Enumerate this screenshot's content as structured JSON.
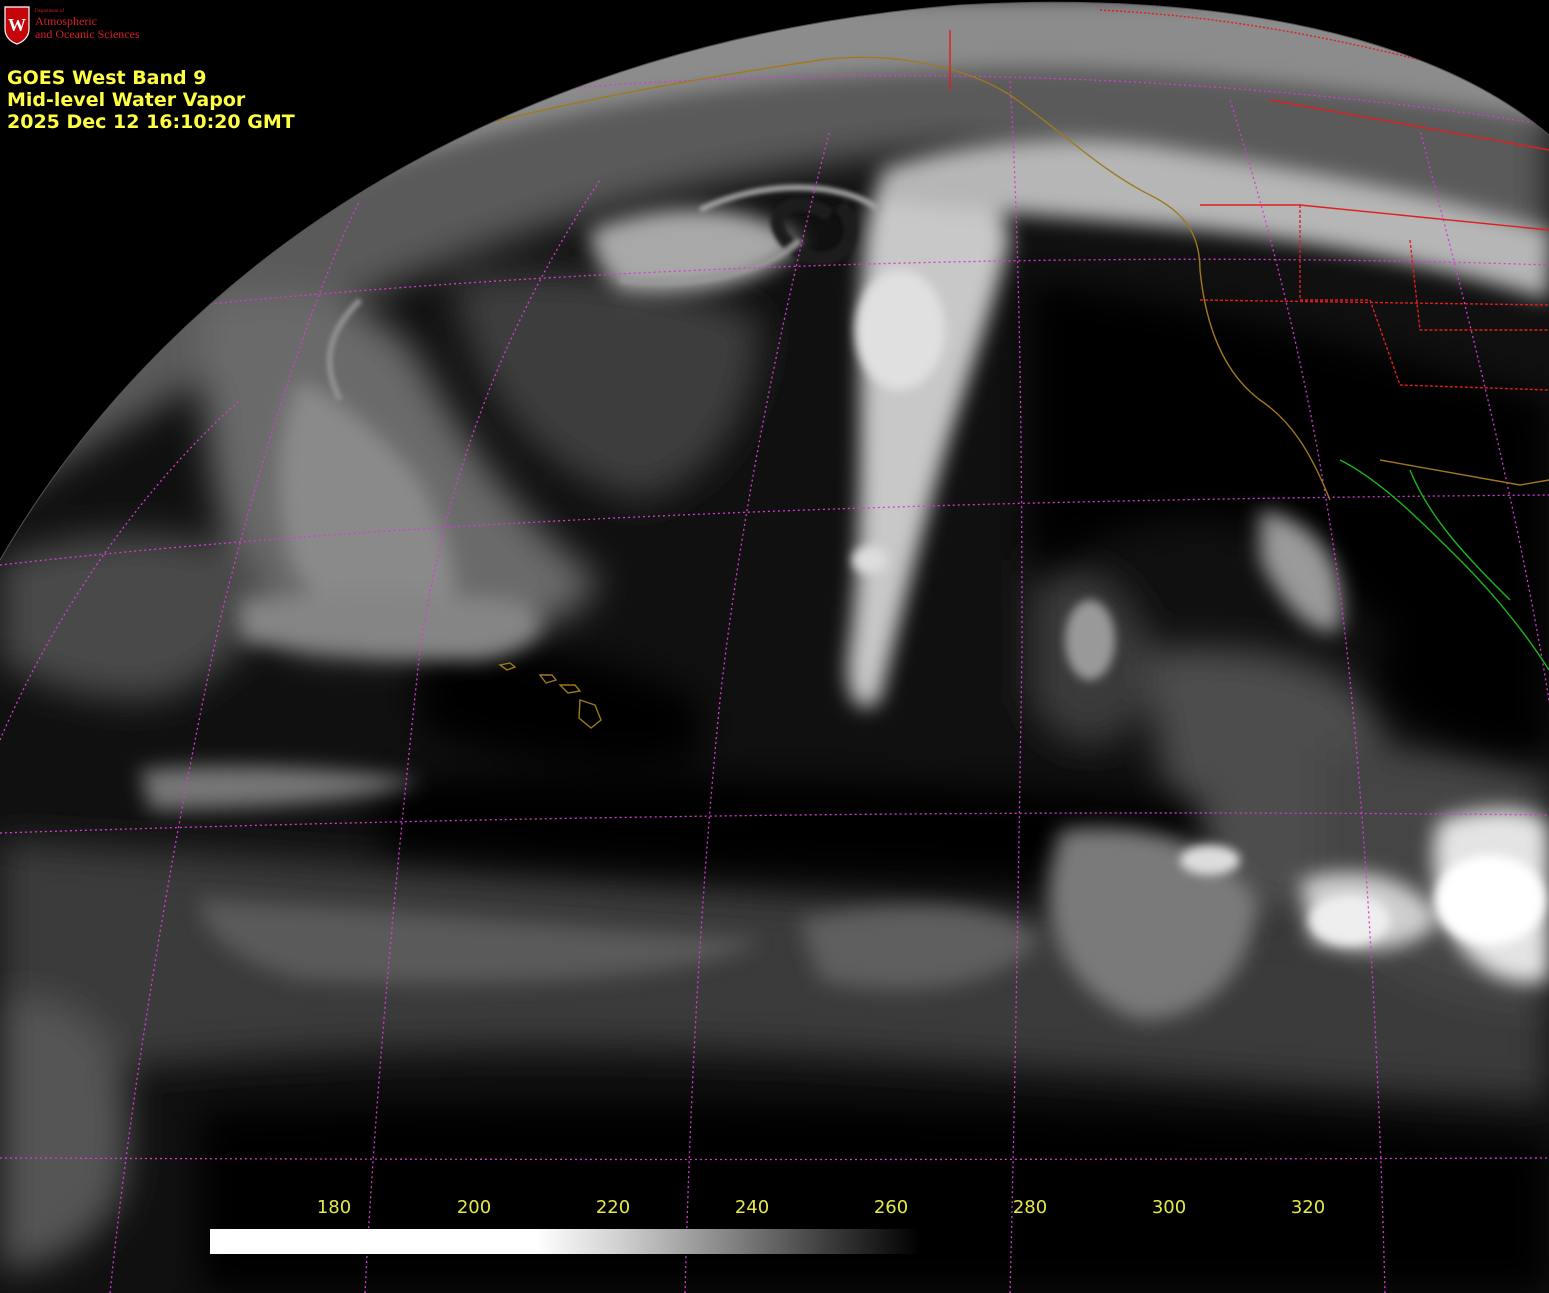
{
  "logo": {
    "department": "Department of",
    "line1": "Atmospheric",
    "line2": "and Oceanic Sciences",
    "seal_letter": "W",
    "color": "#d61e2b"
  },
  "title": {
    "line1": "GOES West Band 9",
    "line2": "Mid-level Water Vapor",
    "line3": "2025 Dec 12  16:10:20 GMT",
    "color": "#ffff44"
  },
  "colorbar": {
    "ticks": [
      "180",
      "200",
      "220",
      "240",
      "260",
      "280",
      "300",
      "320"
    ],
    "tick_color": "#e8e84a",
    "gradient_from": "#ffffff",
    "gradient_to": "#000000"
  },
  "overlay_colors": {
    "graticule": "#d43cd4",
    "state_borders": "#e01e1e",
    "coastlines": "#a0781e",
    "mexico_coast": "#1eb41e"
  }
}
